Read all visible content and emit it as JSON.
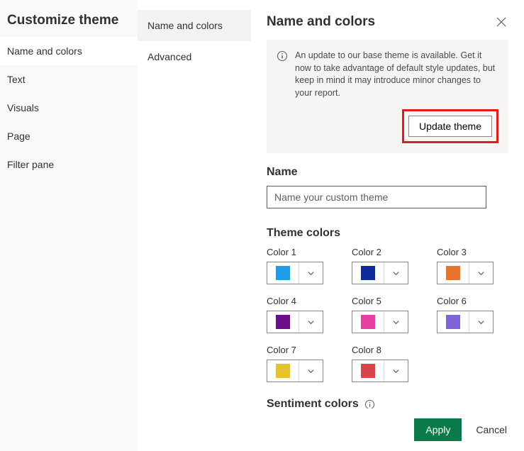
{
  "leftNav": {
    "title": "Customize theme",
    "items": [
      "Name and colors",
      "Text",
      "Visuals",
      "Page",
      "Filter pane"
    ],
    "selectedIndex": 0
  },
  "subNav": {
    "items": [
      "Name and colors",
      "Advanced"
    ],
    "selectedIndex": 0
  },
  "panel": {
    "title": "Name and colors",
    "info": {
      "text": "An update to our base theme is available. Get it now to take advantage of default style updates, but keep in mind it may introduce minor changes to your report.",
      "button": "Update theme"
    },
    "name": {
      "label": "Name",
      "placeholder": "Name your custom theme",
      "value": ""
    },
    "themeColors": {
      "label": "Theme colors",
      "colors": [
        {
          "label": "Color 1",
          "hex": "#1f9ce8"
        },
        {
          "label": "Color 2",
          "hex": "#0f2b9c"
        },
        {
          "label": "Color 3",
          "hex": "#e8732c"
        },
        {
          "label": "Color 4",
          "hex": "#6b0e8a"
        },
        {
          "label": "Color 5",
          "hex": "#e63ea3"
        },
        {
          "label": "Color 6",
          "hex": "#8064d6"
        },
        {
          "label": "Color 7",
          "hex": "#e6c22e"
        },
        {
          "label": "Color 8",
          "hex": "#d9444a"
        }
      ]
    },
    "sentiment": {
      "label": "Sentiment colors"
    },
    "footer": {
      "apply": "Apply",
      "cancel": "Cancel"
    }
  }
}
